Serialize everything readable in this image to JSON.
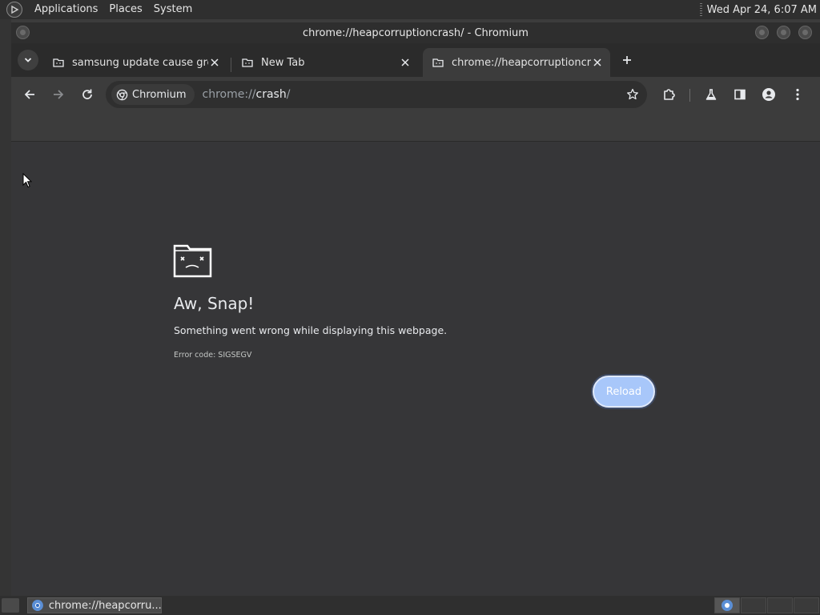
{
  "top_panel": {
    "menus": [
      "Applications",
      "Places",
      "System"
    ],
    "clock": "Wed Apr 24,  6:07 AM"
  },
  "window": {
    "title": "chrome://heapcorruptioncrash/ - Chromium"
  },
  "tabs": [
    {
      "title": "samsung update cause green",
      "active": false
    },
    {
      "title": "New Tab",
      "active": false
    },
    {
      "title": "chrome://heapcorruptioncrash/",
      "active": true
    }
  ],
  "toolbar": {
    "site_chip": "Chromium",
    "url_scheme": "chrome://",
    "url_host": "crash",
    "url_path": "/"
  },
  "page": {
    "title": "Aw, Snap!",
    "message": "Something went wrong while displaying this webpage.",
    "error_code": "Error code: SIGSEGV",
    "reload_label": "Reload"
  },
  "taskbar": {
    "task_label": "chrome://heapcorru..."
  },
  "colors": {
    "accent": "#a8c7fa",
    "page_bg": "#363638",
    "toolbar_bg": "#3c3c3c"
  }
}
